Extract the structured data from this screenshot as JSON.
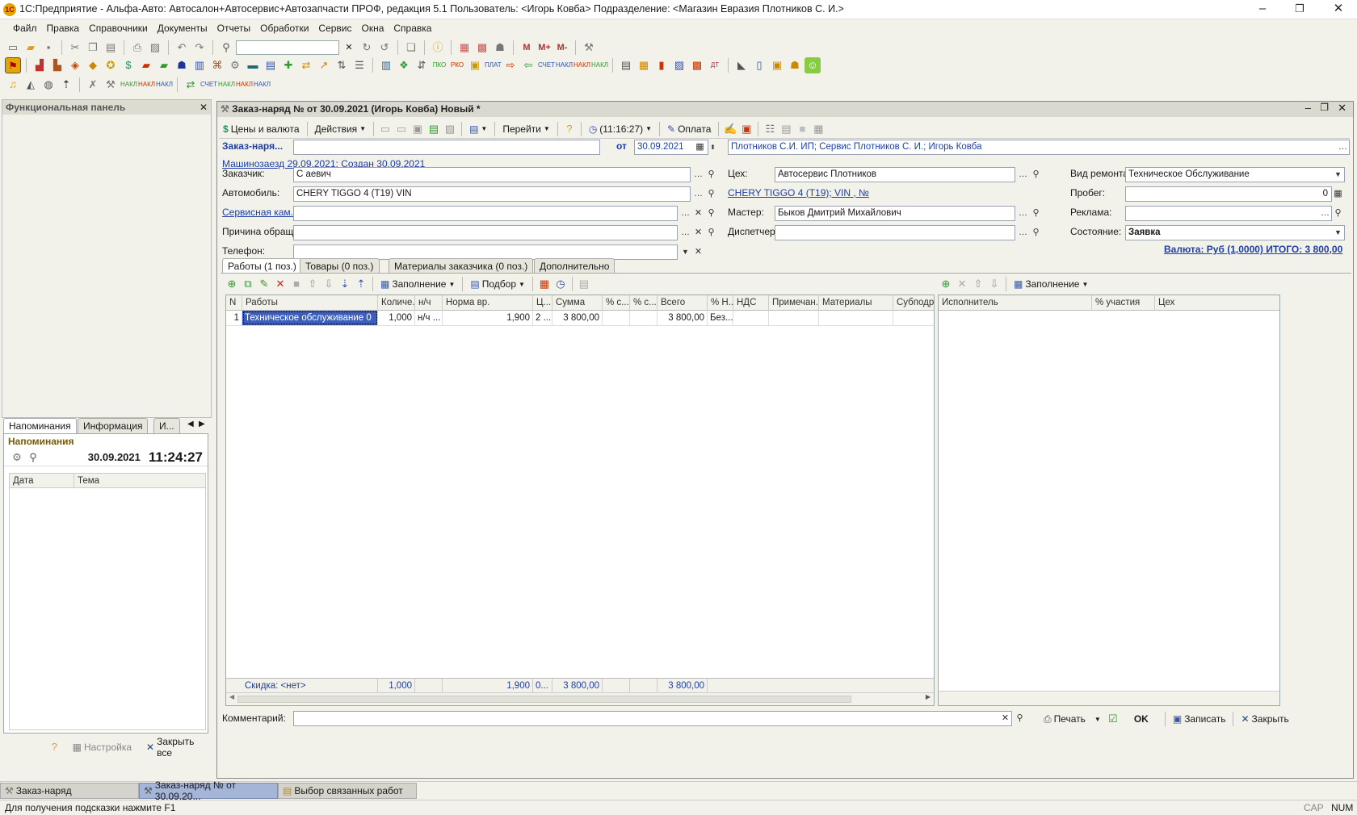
{
  "window": {
    "title": "1С:Предприятие - Альфа-Авто: Автосалон+Автосервис+Автозапчасти ПРОФ, редакция 5.1    Пользователь: <Игорь Ковба>    Подразделение: <Магазин Евразия Плотников С. И.>"
  },
  "menu": [
    "Файл",
    "Правка",
    "Справочники",
    "Документы",
    "Отчеты",
    "Обработки",
    "Сервис",
    "Окна",
    "Справка"
  ],
  "left": {
    "title": "Функциональная панель",
    "tabs": [
      "Напоминания",
      "Информация",
      "И..."
    ],
    "reminders_title": "Напоминания",
    "date": "30.09.2021",
    "time": "11:24:27",
    "col_date": "Дата",
    "col_topic": "Тема",
    "settings": "Настройка",
    "close_all": "Закрыть все"
  },
  "doc": {
    "title": "Заказ-наряд №  от 30.09.2021 (Игорь Ковба) Новый *",
    "toolbar": {
      "prices": "Цены и валюта",
      "actions": "Действия",
      "goto": "Перейти",
      "time": "(11:16:27)",
      "pay": "Оплата"
    },
    "header": {
      "label": "Заказ-наря...",
      "number": "",
      "from": "от",
      "date": "30.09.2021",
      "org": "Плотников С.И. ИП; Сервис Плотников С. И.; Игорь Ковба"
    },
    "link_arrival": "Машинозаезд 29.09.2021; Создан 30.09.2021",
    "fields": {
      "customer_l": "Заказчик:",
      "customer": "С                    аевич",
      "car_l": "Автомобиль:",
      "car": "CHERY TIGGO 4 (T19) VIN",
      "campaign_l": "Сервисная кам...",
      "campaign": "",
      "reason_l": "Причина обращ...",
      "reason": "",
      "phone_l": "Телефон:",
      "phone": "",
      "shop_l": "Цех:",
      "shop": "Автосервис Плотников",
      "car_link": "CHERY TIGGO 4 (T19); VIN           ,  №",
      "master_l": "Мастер:",
      "master": "Быков Дмитрий Михайлович",
      "dispatcher_l": "Диспетчер:",
      "dispatcher": "",
      "repair_l": "Вид ремонта:",
      "repair": "Техническое Обслуживание",
      "mileage_l": "Пробег:",
      "mileage": "0",
      "ads_l": "Реклама:",
      "ads": "",
      "state_l": "Состояние:",
      "state": "Заявка",
      "currency": "Валюта: Руб (1,0000) ИТОГО: 3 800,00"
    },
    "tabs": [
      "Работы (1 поз.)",
      "Товары (0 поз.)",
      "Материалы заказчика (0 поз.)",
      "Дополнительно"
    ],
    "table_toolbar": {
      "fill": "Заполнение",
      "pick": "Подбор"
    },
    "columns": [
      "N",
      "Работы",
      "Количе...",
      "н/ч",
      "Норма вр.",
      "Ц...",
      "Сумма",
      "% с...",
      "% с...",
      "Всего",
      "% Н...",
      "НДС",
      "Примечан...",
      "Материалы",
      "Субподряд"
    ],
    "rows": [
      {
        "n": "1",
        "work": "Техническое обслуживание 0",
        "qty": "1,000",
        "nh": "н/ч ...",
        "norm": "1,900",
        "c": "2 ...",
        "sum": "3 800,00",
        "p1": "",
        "p2": "",
        "total": "3 800,00",
        "pn": "Без...",
        "vat": "",
        "note": "",
        "mat": "",
        "sub": ""
      }
    ],
    "footer": {
      "discount": "Скидка: <нет>",
      "qty": "1,000",
      "norm": "1,900",
      "c": "0...",
      "sum": "3 800,00",
      "total": "3 800,00"
    },
    "exec_toolbar": {
      "fill": "Заполнение"
    },
    "exec_columns": [
      "Исполнитель",
      "% участия",
      "Цех"
    ],
    "comment_l": "Комментарий:",
    "comment": "",
    "bottom": {
      "print": "Печать",
      "ok": "OK",
      "save": "Записать",
      "close": "Закрыть"
    }
  },
  "taskbar": [
    "Заказ-наряд",
    "Заказ-наряд №  от 30.09.20...",
    "Выбор связанных работ"
  ],
  "status": {
    "hint": "Для получения подсказки нажмите F1",
    "cap": "CAP",
    "num": "NUM"
  }
}
